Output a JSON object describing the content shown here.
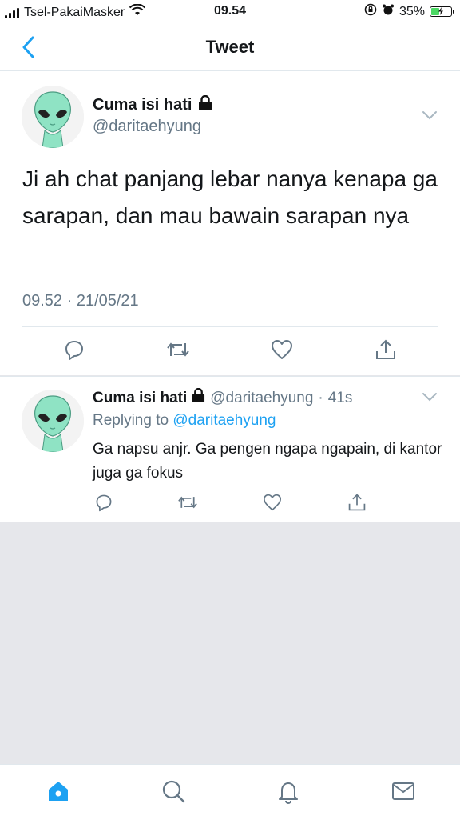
{
  "status_bar": {
    "carrier": "Tsel-PakaiMasker",
    "time": "09.54",
    "battery_percent": "35%"
  },
  "nav": {
    "title": "Tweet",
    "back_icon": "chevron-left-icon"
  },
  "main_tweet": {
    "display_name": "Cuma isi hati",
    "handle": "@daritaehyung",
    "text": "Ji ah chat panjang lebar nanya kenapa ga sarapan, dan mau bawain sarapan nya",
    "timestamp": "09.52 · 21/05/21",
    "actions": [
      "reply-icon",
      "retweet-icon",
      "like-icon",
      "share-icon"
    ]
  },
  "reply_tweet": {
    "display_name": "Cuma isi hati",
    "handle": "@daritaehyung",
    "separator": "·",
    "age": "41s",
    "replying_prefix": "Replying to",
    "replying_handle": "@daritaehyung",
    "text": "Ga napsu anjr. Ga pengen ngapa ngapain, di kantor juga ga fokus",
    "actions": [
      "reply-icon",
      "retweet-icon",
      "like-icon",
      "share-icon"
    ]
  },
  "tab_bar": {
    "tabs": [
      "home-icon",
      "search-icon",
      "notifications-icon",
      "messages-icon"
    ]
  },
  "colors": {
    "accent": "#1da1f2",
    "secondary_text": "#657786",
    "background": "#e6e7eb",
    "avatar_alien": "#8fe3c4"
  }
}
